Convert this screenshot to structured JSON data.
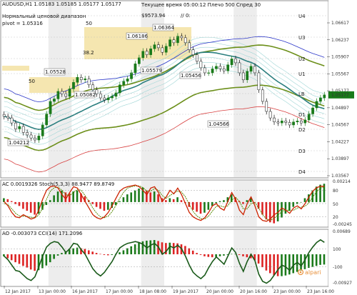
{
  "header": {
    "symbol_line": "AUDUSD,H1  1.05183 1.05185 1.05177 1.05177",
    "subtitle": "Нормальный ценовой диапазон",
    "pivot_label": "pivot = 1.05316",
    "server_time": "Текущее время 05:00:12  Плечо 500  Спред 30",
    "balance": "$9573.94",
    "counter": "// 0:"
  },
  "colors": {
    "bull": "#1a7a1a",
    "bear": "#111111",
    "hma": "#2a7f7f",
    "bb_outer": "#6c8f1a",
    "envelope_blue": "#2b36c9",
    "envelope_red": "#d84040",
    "stoch_main": "#cc2200",
    "stoch_signal": "#558800",
    "hist_red": "#dd2222",
    "hist_green": "#1a7a1a",
    "cci": "#1a5a1a"
  },
  "chart_data": [
    {
      "type": "candlestick",
      "title": "AUDUSD,H1",
      "ylim": [
        1.03567,
        1.06617
      ],
      "y_ticks": [
        "1.06617",
        "1.06237",
        "1.05907",
        "1.05567",
        "1.05177",
        "1.04897",
        "1.04567",
        "1.04227",
        "1.03897",
        "1.03567"
      ],
      "price_labels": [
        "1.04212",
        "1.05528",
        "1.05082",
        "1.06186",
        "1.06364",
        "1.05579",
        "1.05456",
        "1.04566"
      ],
      "fib_labels": [
        "50",
        "38.2",
        "50"
      ],
      "levels": [
        "U4",
        "U3",
        "U2",
        "U1",
        "LB",
        "D1",
        "D2",
        "D3",
        "D4"
      ],
      "x_labels": [
        "12 Jan 2017",
        "13 Jan 00:00",
        "16 Jan 2017",
        "17 Jan 00:00",
        "18 Jan 08:00",
        "19 Jan 2017",
        "20 Jan 00:00",
        "20 Jan 16:00",
        "23 Jan 00:00",
        "23 Jan 16:00"
      ],
      "close": [
        1.0475,
        1.0472,
        1.0462,
        1.045,
        1.0455,
        1.0443,
        1.0438,
        1.0432,
        1.0428,
        1.0436,
        1.0458,
        1.048,
        1.0505,
        1.051,
        1.0525,
        1.052,
        1.0515,
        1.053,
        1.0543,
        1.0553,
        1.0548,
        1.055,
        1.0538,
        1.0528,
        1.052,
        1.0512,
        1.0508,
        1.0512,
        1.0515,
        1.0522,
        1.0538,
        1.0545,
        1.055,
        1.0562,
        1.058,
        1.0592,
        1.0605,
        1.0598,
        1.061,
        1.0618,
        1.0612,
        1.0603,
        1.0615,
        1.0628,
        1.0622,
        1.0635,
        1.0632,
        1.0622,
        1.0608,
        1.0598,
        1.0585,
        1.0572,
        1.0562,
        1.0562,
        1.057,
        1.0575,
        1.057,
        1.0566,
        1.0578,
        1.059,
        1.0582,
        1.0562,
        1.0548,
        1.0565,
        1.0575,
        1.0562,
        1.0528,
        1.0505,
        1.0485,
        1.0472,
        1.0464,
        1.0462,
        1.0466,
        1.0463,
        1.0458,
        1.0464,
        1.0466,
        1.0462,
        1.0468,
        1.048,
        1.0492,
        1.0505,
        1.0512,
        1.0518
      ]
    },
    {
      "type": "histogram",
      "title": "AC 0.0019326  Stoch(5,3,3) 88.9477 89.8749",
      "ylim": [
        -0.00245,
        0.00214
      ],
      "y_ticks": [
        "0.00214",
        "80",
        "50",
        "20",
        "-0.00245"
      ],
      "stoch_levels": [
        80,
        50,
        20
      ],
      "ac": [
        0.0004,
        0.0003,
        0.0001,
        -0.0002,
        -0.0004,
        -0.0007,
        -0.0009,
        -0.0011,
        -0.0013,
        -0.0012,
        -0.0008,
        -0.0003,
        0.0002,
        0.0007,
        0.0011,
        0.0012,
        0.001,
        0.0009,
        0.0011,
        0.0012,
        0.0009,
        0.0006,
        0.0002,
        -0.0002,
        -0.0005,
        -0.0007,
        -0.0009,
        -0.0008,
        -0.0006,
        -0.0003,
        0.0001,
        0.0005,
        0.0008,
        0.001,
        0.0012,
        0.0014,
        0.0015,
        0.0012,
        0.001,
        0.0011,
        0.0008,
        0.0004,
        0.0002,
        0.0004,
        0.0003,
        0.0005,
        0.0002,
        -0.0001,
        -0.0005,
        -0.0008,
        -0.001,
        -0.0012,
        -0.0011,
        -0.0008,
        -0.0004,
        -0.0001,
        0.0001,
        0.0002,
        0.0005,
        0.0008,
        0.0005,
        0.0001,
        -0.0002,
        0.0002,
        0.0004,
        0.0,
        -0.0007,
        -0.0013,
        -0.0018,
        -0.0021,
        -0.0022,
        -0.002,
        -0.0016,
        -0.0012,
        -0.0009,
        -0.0005,
        -0.0002,
        0.0,
        0.0004,
        0.0008,
        0.0012,
        0.0016,
        0.0018,
        0.0019
      ],
      "stoch_main": [
        55,
        45,
        30,
        20,
        18,
        25,
        20,
        15,
        18,
        35,
        60,
        80,
        88,
        90,
        85,
        70,
        60,
        75,
        88,
        85,
        70,
        55,
        40,
        25,
        18,
        15,
        20,
        30,
        45,
        62,
        78,
        85,
        88,
        90,
        92,
        88,
        80,
        70,
        85,
        88,
        75,
        55,
        65,
        80,
        72,
        85,
        70,
        50,
        30,
        20,
        15,
        12,
        18,
        30,
        45,
        50,
        40,
        35,
        55,
        75,
        60,
        35,
        25,
        50,
        65,
        45,
        20,
        12,
        10,
        15,
        25,
        30,
        40,
        35,
        28,
        40,
        45,
        38,
        50,
        65,
        78,
        86,
        89,
        89
      ],
      "stoch_signal": [
        50,
        48,
        38,
        28,
        22,
        22,
        21,
        19,
        18,
        24,
        40,
        60,
        78,
        86,
        87,
        80,
        70,
        68,
        75,
        82,
        80,
        68,
        55,
        40,
        28,
        20,
        18,
        22,
        32,
        46,
        62,
        76,
        85,
        88,
        90,
        90,
        86,
        78,
        78,
        84,
        80,
        68,
        62,
        68,
        74,
        78,
        76,
        65,
        48,
        32,
        22,
        16,
        15,
        22,
        33,
        44,
        45,
        42,
        45,
        58,
        64,
        55,
        38,
        38,
        50,
        52,
        40,
        25,
        15,
        12,
        17,
        24,
        32,
        36,
        34,
        35,
        40,
        42,
        44,
        52,
        65,
        77,
        85,
        88
      ]
    },
    {
      "type": "histogram",
      "title": "AO -0.003073  CCI(14) 171.2096",
      "ylim": [
        -0.00927,
        0.00689
      ],
      "y_ticks": [
        "0.00689",
        "100",
        "-100",
        "-0.00927"
      ],
      "cci_levels": [
        100,
        -100
      ],
      "ao": [
        -0.0006,
        -0.0012,
        -0.0018,
        -0.0024,
        -0.0029,
        -0.0035,
        -0.004,
        -0.0046,
        -0.005,
        -0.0048,
        -0.0042,
        -0.0034,
        -0.0024,
        -0.0014,
        -0.0004,
        0.0004,
        0.0009,
        0.0014,
        0.0018,
        0.002,
        0.0018,
        0.0016,
        0.0012,
        0.0008,
        0.0004,
        0.0001,
        -0.0002,
        -0.0003,
        -0.0002,
        0.0001,
        0.0006,
        0.0012,
        0.0018,
        0.0024,
        0.003,
        0.0035,
        0.0039,
        0.0041,
        0.0042,
        0.0043,
        0.004,
        0.0036,
        0.0034,
        0.0035,
        0.0034,
        0.0033,
        0.003,
        0.0025,
        0.0018,
        0.0011,
        0.0004,
        -0.0002,
        -0.0006,
        -0.0008,
        -0.0009,
        -0.0008,
        -0.0006,
        -0.0004,
        -0.0002,
        0.0001,
        0.0001,
        -0.0002,
        -0.0006,
        -0.0009,
        -0.0012,
        -0.0018,
        -0.0028,
        -0.0039,
        -0.0049,
        -0.0057,
        -0.0063,
        -0.0066,
        -0.0066,
        -0.0064,
        -0.0061,
        -0.0057,
        -0.0053,
        -0.0049,
        -0.0045,
        -0.0041,
        -0.0038,
        -0.0035,
        -0.0032,
        -0.0031
      ],
      "cci": [
        20,
        -20,
        -80,
        -140,
        -150,
        -190,
        -230,
        -250,
        -210,
        -100,
        20,
        120,
        160,
        180,
        170,
        120,
        60,
        100,
        160,
        150,
        90,
        40,
        -40,
        -120,
        -170,
        -200,
        -160,
        -100,
        -40,
        40,
        110,
        140,
        160,
        170,
        180,
        170,
        150,
        110,
        140,
        160,
        120,
        40,
        70,
        130,
        110,
        140,
        100,
        20,
        -80,
        -160,
        -200,
        -230,
        -190,
        -110,
        -40,
        10,
        -30,
        -70,
        20,
        110,
        60,
        -60,
        -150,
        -40,
        40,
        -30,
        -180,
        -260,
        -280,
        -250,
        -190,
        -130,
        -80,
        -100,
        -140,
        -80,
        -50,
        -90,
        -20,
        60,
        120,
        170,
        200,
        171
      ]
    }
  ]
}
